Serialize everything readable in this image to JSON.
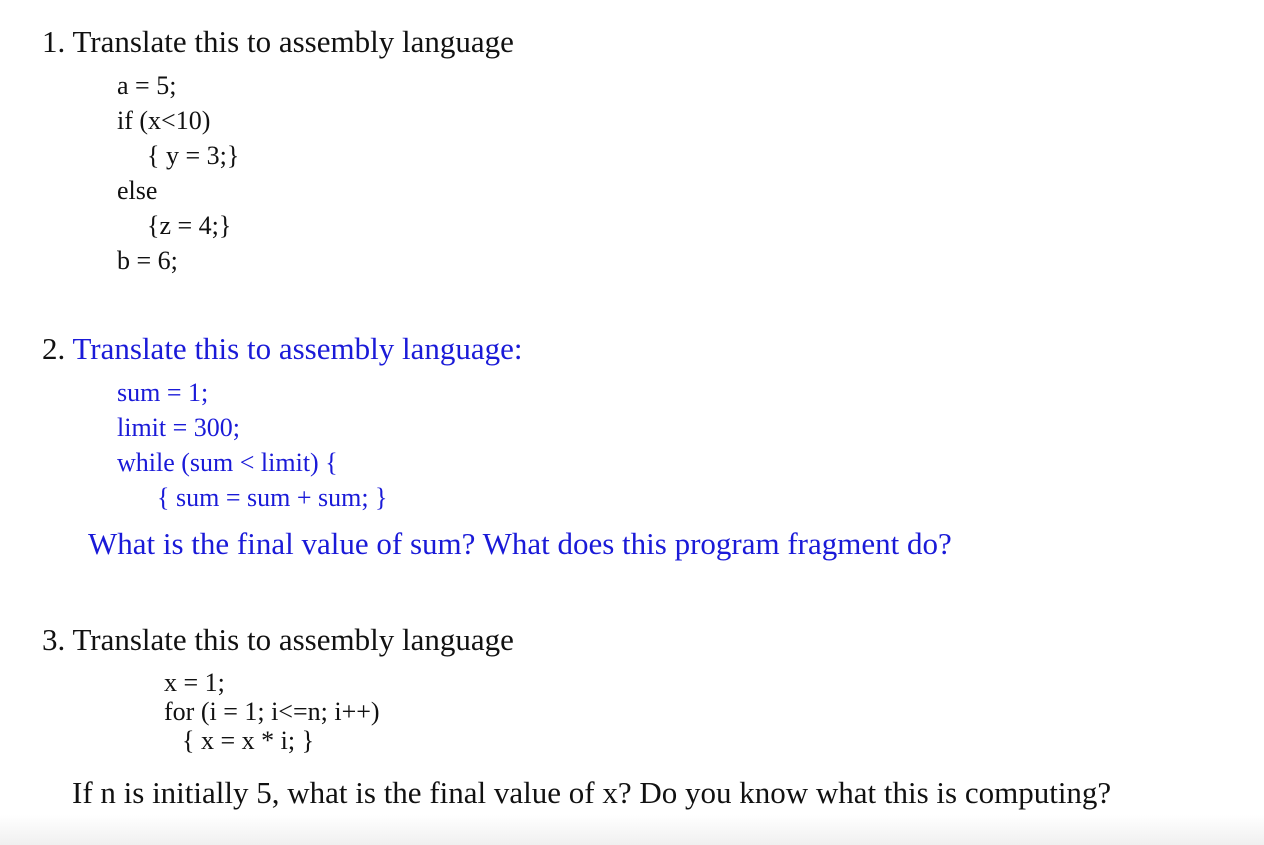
{
  "colors": {
    "text": "#111111",
    "accent_blue": "#1a1ad8",
    "background": "#ffffff"
  },
  "problem1": {
    "heading": "1. Translate this to assembly language",
    "code": [
      "a = 5;",
      "if (x<10)",
      "{ y = 3;}",
      "else",
      "{z = 4;}",
      "b = 6;"
    ]
  },
  "problem2": {
    "heading": "2. Translate this to assembly language:",
    "code": [
      "sum = 1;",
      "limit = 300;",
      "while (sum < limit) {",
      "{ sum = sum + sum; }"
    ],
    "question": "What is the final value of sum? What does this program fragment do?"
  },
  "problem3": {
    "heading": "3. Translate this to assembly language",
    "code": [
      "x = 1;",
      "for (i = 1; i<=n; i++)",
      "{ x = x * i; }"
    ],
    "question": "If n is initially 5, what is the final value of x?  Do you know what this is computing?"
  }
}
